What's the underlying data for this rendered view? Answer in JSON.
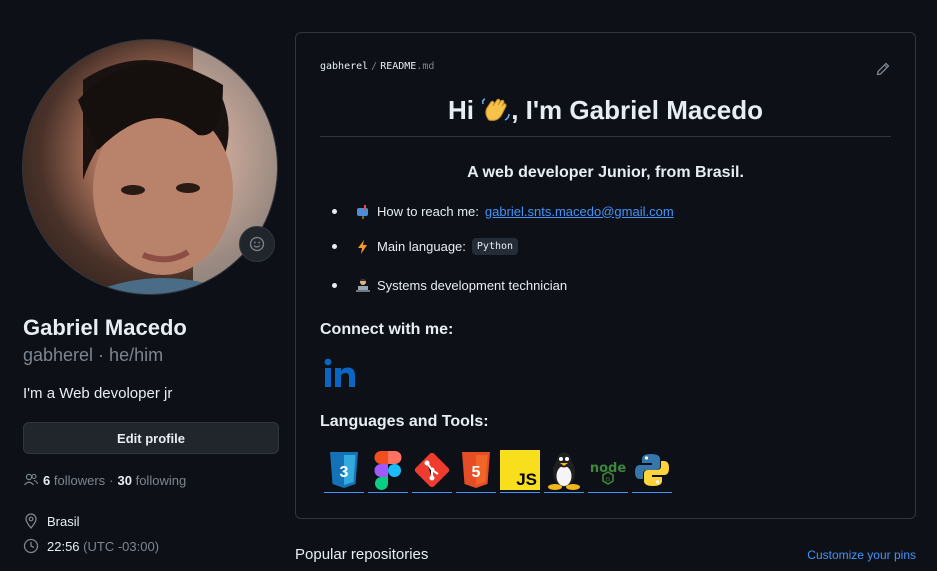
{
  "profile": {
    "name": "Gabriel Macedo",
    "login": "gabherel · he/him",
    "bio": "I'm a Web devoloper jr",
    "edit_label": "Edit profile",
    "followers_count": "6",
    "followers_label": "followers",
    "separator": "·",
    "following_count": "30",
    "following_label": "following",
    "location": "Brasil",
    "time": "22:56",
    "timezone": "(UTC -03:00)"
  },
  "readme": {
    "owner": "gabherel",
    "path_sep": "/",
    "file_base": "README",
    "file_ext": ".md",
    "title_pre": "Hi",
    "title_post": ", I'm Gabriel Macedo",
    "subtitle": "A web developer Junior, from Brasil.",
    "reach_label": "How to reach me:",
    "reach_email": "gabriel.snts.macedo@gmail.com",
    "lang_label": "Main language:",
    "lang_value": "Python",
    "job_label": "Systems development technician",
    "connect_heading": "Connect with me:",
    "tools_heading": "Languages and Tools:",
    "tool_icons": [
      "css3-icon",
      "figma-icon",
      "git-icon",
      "html5-icon",
      "javascript-icon",
      "linux-icon",
      "nodejs-icon",
      "python-icon"
    ]
  },
  "footer": {
    "popular": "Popular repositories",
    "customize": "Customize your pins"
  },
  "colors": {
    "background": "#0d1117",
    "border": "#30363d",
    "text": "#e6edf3",
    "muted": "#7d8590",
    "link": "#4493f8"
  }
}
